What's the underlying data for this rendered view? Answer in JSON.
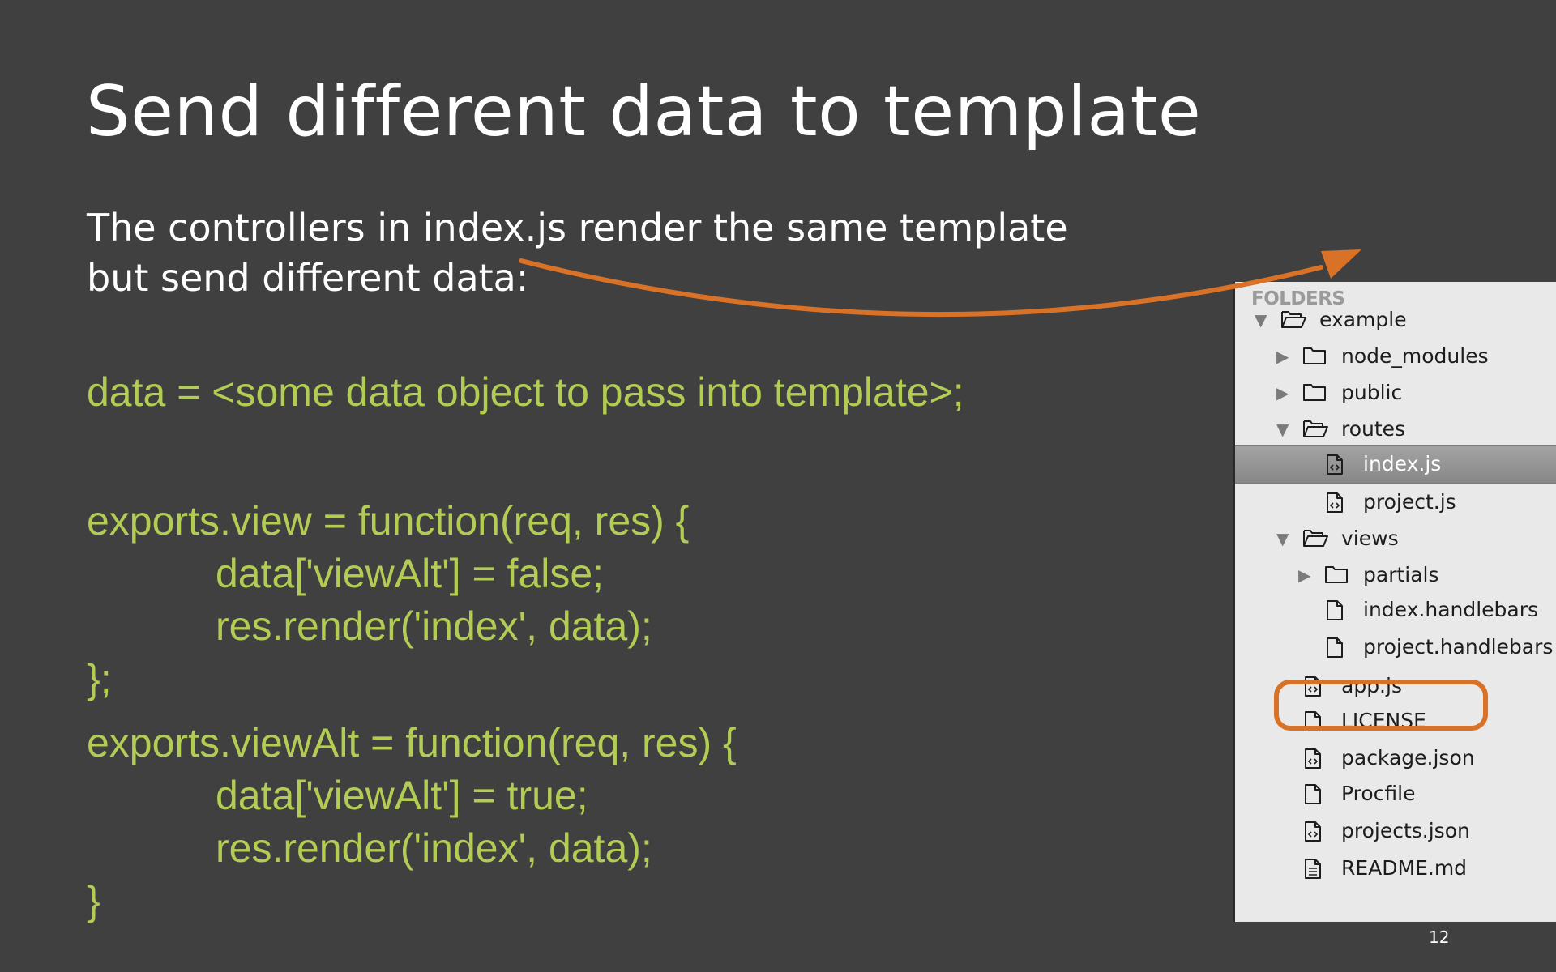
{
  "slide": {
    "title": "Send different data to template",
    "intro_lines": [
      "The controllers in index.js render the same template",
      "but send different data:"
    ],
    "code_data_line": "data = <some data object to pass into template>;",
    "code_block_1": [
      "exports.view = function(req, res) {",
      "data['viewAlt'] = false;",
      "res.render('index', data);",
      "};"
    ],
    "code_block_2": [
      "exports.viewAlt = function(req, res) {",
      "data['viewAlt'] = true;",
      "res.render('index', data);",
      "}"
    ],
    "page_number": "12"
  },
  "sidebar": {
    "header": "FOLDERS",
    "items": [
      {
        "label": "example",
        "type": "folder",
        "expanded": true,
        "icon": "folder-open-icon"
      },
      {
        "label": "node_modules",
        "type": "folder",
        "expanded": false,
        "icon": "folder-icon"
      },
      {
        "label": "public",
        "type": "folder",
        "expanded": false,
        "icon": "folder-icon"
      },
      {
        "label": "routes",
        "type": "folder",
        "expanded": true,
        "icon": "folder-open-icon"
      },
      {
        "label": "index.js",
        "type": "file",
        "selected": true,
        "icon": "code-file-icon"
      },
      {
        "label": "project.js",
        "type": "file",
        "icon": "code-file-icon"
      },
      {
        "label": "views",
        "type": "folder",
        "expanded": true,
        "icon": "folder-open-icon"
      },
      {
        "label": "partials",
        "type": "folder",
        "expanded": false,
        "icon": "folder-icon"
      },
      {
        "label": "index.handlebars",
        "type": "file",
        "icon": "file-icon"
      },
      {
        "label": "project.handlebars",
        "type": "file",
        "icon": "file-icon"
      },
      {
        "label": "app.js",
        "type": "file",
        "highlighted": true,
        "icon": "code-file-icon"
      },
      {
        "label": "LICENSE",
        "type": "file",
        "icon": "file-icon"
      },
      {
        "label": "package.json",
        "type": "file",
        "icon": "code-file-icon"
      },
      {
        "label": "Procfile",
        "type": "file",
        "icon": "file-icon"
      },
      {
        "label": "projects.json",
        "type": "file",
        "icon": "code-file-icon"
      },
      {
        "label": "README.md",
        "type": "file",
        "icon": "text-file-icon"
      }
    ]
  },
  "colors": {
    "background": "#404040",
    "code": "#b2cc54",
    "accent": "#d97227",
    "sidebar_background": "#e9e9e9"
  }
}
